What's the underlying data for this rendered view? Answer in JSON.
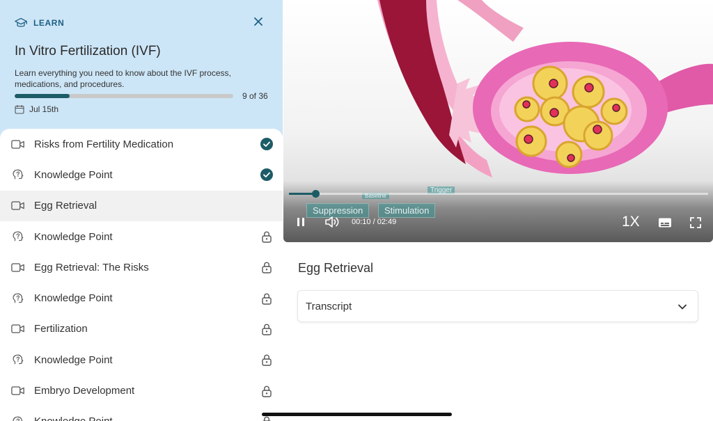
{
  "header": {
    "section_label": "LEARN",
    "course_title": "In Vitro Fertilization (IVF)",
    "description": "Learn everything you need to know about the IVF process, medications, and procedures.",
    "progress_text": "9 of 36",
    "progress_fraction": 0.25,
    "date": "Jul 15th"
  },
  "lessons": [
    {
      "label": "Risks from Fertility Medication",
      "type": "video",
      "status": "done"
    },
    {
      "label": "Knowledge Point",
      "type": "knowledge",
      "status": "done"
    },
    {
      "label": "Egg Retrieval",
      "type": "video",
      "status": "current"
    },
    {
      "label": "Knowledge Point",
      "type": "knowledge",
      "status": "locked"
    },
    {
      "label": "Egg Retrieval: The Risks",
      "type": "video",
      "status": "locked"
    },
    {
      "label": "Knowledge Point",
      "type": "knowledge",
      "status": "locked"
    },
    {
      "label": "Fertilization",
      "type": "video",
      "status": "locked"
    },
    {
      "label": "Knowledge Point",
      "type": "knowledge",
      "status": "locked"
    },
    {
      "label": "Embryo Development",
      "type": "video",
      "status": "locked"
    },
    {
      "label": "Knowledge Point",
      "type": "knowledge",
      "status": "locked"
    }
  ],
  "player": {
    "time": "00:10 / 02:49",
    "progress_fraction": 0.063,
    "speed": "1X",
    "overlay_labels": {
      "suppression": "Suppression",
      "stimulation": "Stimulation",
      "baseline": "Baseline",
      "trigger": "Trigger"
    }
  },
  "content": {
    "lesson_title": "Egg Retrieval",
    "transcript_label": "Transcript"
  },
  "colors": {
    "header_bg": "#cde6f7",
    "accent": "#1c5c66",
    "check": "#1c5c66"
  }
}
